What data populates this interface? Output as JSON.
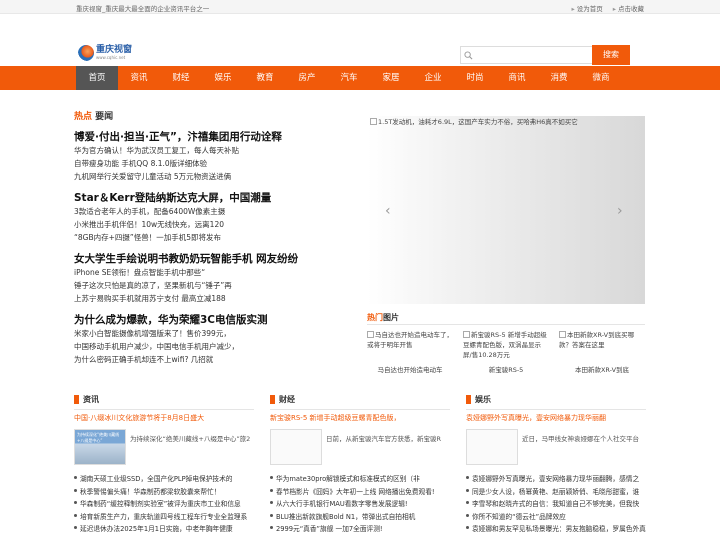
{
  "topbar": {
    "tagline": "重庆视窗_重庆最大最全面的企业资讯平台之一",
    "set_home": "设为首页",
    "bookmark": "点击收藏"
  },
  "header": {
    "logo_cn": "重庆视窗",
    "logo_en": "www.cqhic.net",
    "search_placeholder": "",
    "search_button": "搜索"
  },
  "nav": [
    "首页",
    "资讯",
    "财经",
    "娱乐",
    "教育",
    "房产",
    "汽车",
    "家居",
    "企业",
    "时尚",
    "商讯",
    "消费",
    "微商"
  ],
  "hot": {
    "title_red": "热点",
    "title_rest": "要闻",
    "groups": [
      {
        "headline": "博爱·付出·担当·正气”，汴禧集团用行动诠释",
        "items": [
          "华为官方确认！华为武汉员工复工，每人每天补贴",
          "自带瘦身功能 手机QQ 8.1.0版详细体验",
          "九机网举行关爱留守儿童活动 5万元物资送进俩"
        ]
      },
      {
        "headline": "Star＆Kerr登陆纳斯达克大屏，中国潮量",
        "items": [
          "3款适合老年人的手机，配备6400W像素主摄",
          "小米推出手机伴侣！10w无线快充，远离120",
          "“8GB内存+四摄”怪兽！一加手机5即将发布"
        ]
      },
      {
        "headline": "女大学生手绘说明书教奶奶玩智能手机 网友纷纷",
        "items": [
          "iPhone SE领衔！盘点智能手机中那些“",
          "锤子这次只怕是真的凉了，坚果新机与“锤子”再",
          "上苏宁易购买手机就用苏宁支付 最高立减188"
        ]
      },
      {
        "headline": "为什么成为爆款，华为荣耀3C电信版实测",
        "items": [
          "米家小白智能摄像机增强版来了！售价399元，",
          "中国移动手机用户减少，中国电信手机用户减少，",
          "为什么密码正确手机却连不上wifi? 几招就"
        ]
      }
    ]
  },
  "slider": {
    "caption": "1.5T发动机，油耗才6.9L，这国产车实力不俗，买哈弗H6真不如买它",
    "prev": "‹",
    "next": "›"
  },
  "pictures": {
    "title_red": "热门",
    "title_rest": "图片",
    "items": [
      {
        "alt": "马自达也开始造电动车了，或将于明年开售",
        "caption": "马自达也开始造电动车"
      },
      {
        "alt": "新宝骏RS-5 新增手动超级豆螺青配色版，双涡晶显示屏/售10.28万元",
        "caption": "新宝骏RS-5"
      },
      {
        "alt": "本田新款XR-V到底买哪款？答案在这里",
        "caption": "本田新款XR-V到底"
      }
    ]
  },
  "columns": [
    {
      "title": "资讯",
      "headline": "中国·八缀冰川文化旅游节将于8月8日盛大",
      "thumb_text": "为持续深化“绝美川藏线+八缀是中心”",
      "feat_desc": "为持续深化“绝美川藏线+八缀是中心”旅2",
      "items": [
        "湖南天硕工业级SSD，全国产化PLP掉电保护技术的",
        "秋季警惕偏头痛！华森制药都梁软胶囊来帮忙！",
        "华森制药“缓控释制剂实验室”被评为重庆市工业和信息",
        "培育新质生产力，重庆轨道四号线工程车行专业全监理系",
        "延迟退休办法2025年1月1日实施，中老年胸年健康"
      ]
    },
    {
      "title": "财经",
      "headline": "新宝骏RS-5 新增手动超级豆螺青配色版，",
      "thumb_text": "",
      "feat_desc": "日前，从新宝骏汽车官方获悉，新宝骏R",
      "items": [
        "华为mate30pro解锁模式和标准模式的区别（非",
        "春节档影片《囧妈》大年初一上线 网络播出免费观看!",
        "从六大行手机银行MAU看数字零售发展逻辑!",
        "BLU推出新款旗舰Bold N1，带弹出式自拍相机",
        "2999元“真香”旗舰 一加7全面评测!"
      ]
    },
    {
      "title": "娱乐",
      "headline": "袁娅娜野外写真曝光，壹安网络暴力现华丽翻",
      "thumb_text": "",
      "feat_desc": "近日，马甲线女神袁娅娜在个人社交平台",
      "items": [
        "袁娅娜野外写真曝光，壹安网络暴力现华丽翻腾，感情之",
        "同是少女人设，杨幂黄艳、赵丽颖娇俏、毛晓彤甜蜜，谁",
        "李雪琴和赵晓卉式的自信：我知道自己不够完美，但我快",
        "你所不知道的“德云社”品牌效应",
        "袁娅娜和男友罕见私场景曝光：男友抱脑稳稳，罗属色外真"
      ]
    }
  ]
}
